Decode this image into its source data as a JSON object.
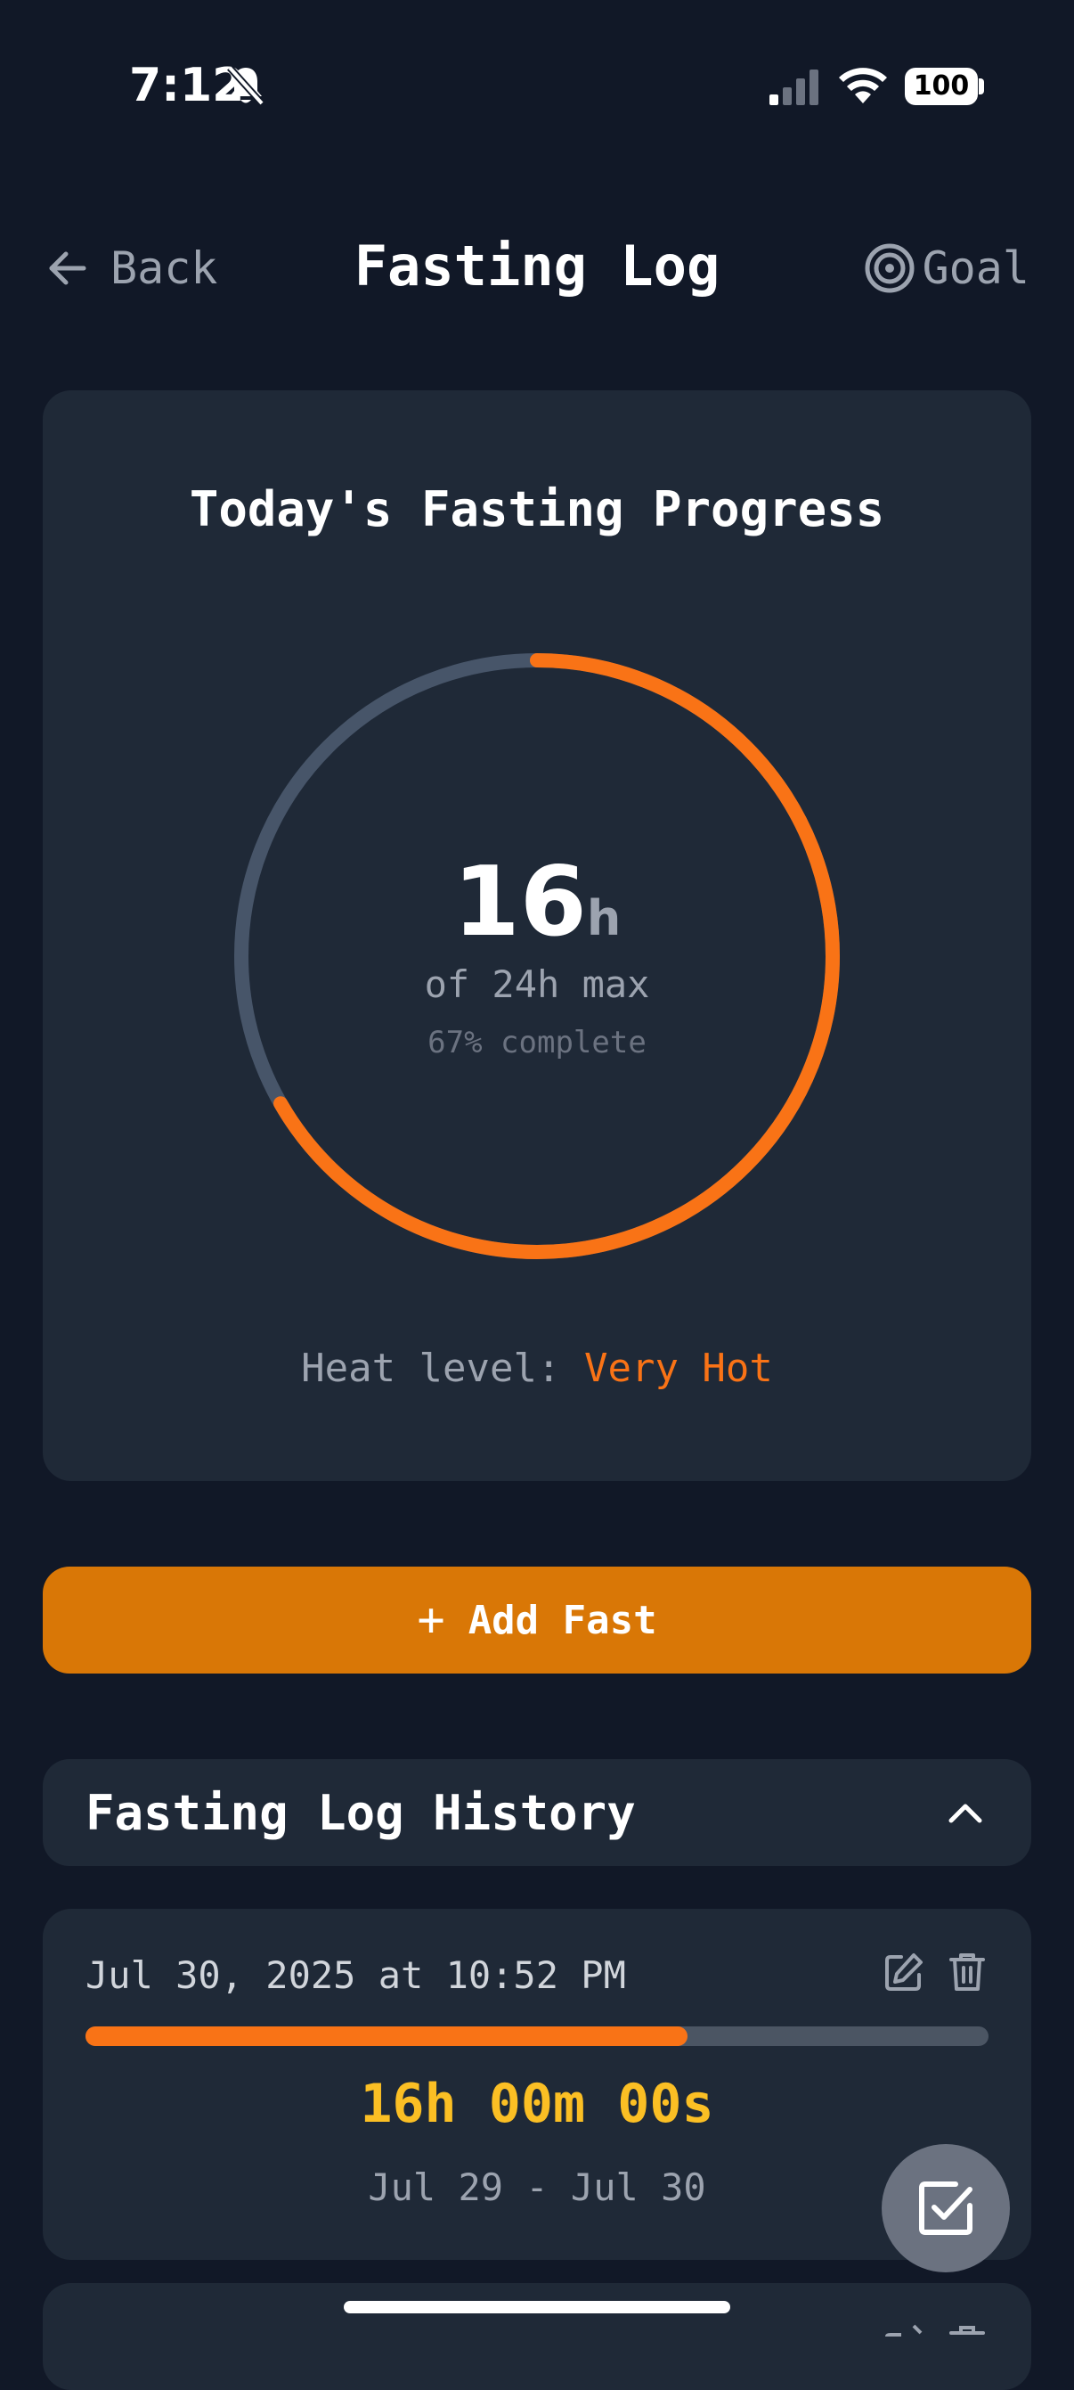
{
  "status_bar": {
    "time": "7:12",
    "battery": "100",
    "icons": [
      "bell-off-icon",
      "signal-icon",
      "wifi-icon",
      "battery-icon"
    ]
  },
  "header": {
    "back_label": "Back",
    "title": "Fasting Log",
    "goal_label": "Goal"
  },
  "progress": {
    "title": "Today's Fasting Progress",
    "hours": "16",
    "unit": "h",
    "of_max": "of 24h max",
    "percent_text": "67% complete",
    "percent_value": 0.667,
    "heat_label": "Heat level: ",
    "heat_value": "Very Hot"
  },
  "actions": {
    "add_fast": "Add Fast"
  },
  "history": {
    "title": "Fasting Log History",
    "entries": [
      {
        "date": "Jul 30, 2025 at 10:52 PM",
        "duration": "16h 00m 00s",
        "range": "Jul 29 - Jul 30",
        "progress": 0.667
      }
    ]
  },
  "colors": {
    "background": "#111827",
    "card": "#1f2937",
    "accent": "#f97316",
    "button": "#d97706",
    "duration": "#fbbf24"
  }
}
